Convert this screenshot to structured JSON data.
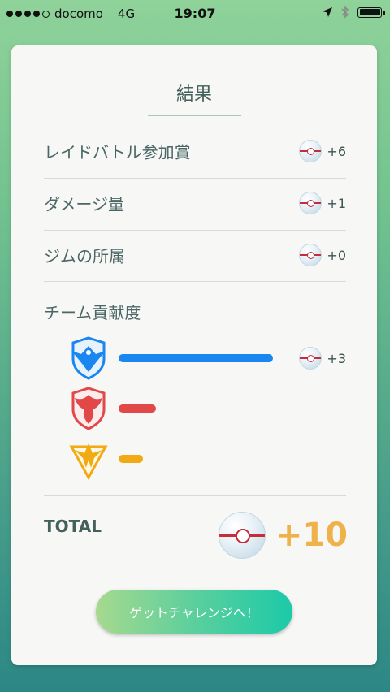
{
  "status_bar": {
    "carrier": "docomo",
    "network": "4G",
    "time": "19:07",
    "icons": [
      "signal-dots-icon",
      "location-arrow-icon",
      "bluetooth-icon",
      "battery-icon"
    ]
  },
  "result": {
    "title": "結果",
    "rows": [
      {
        "label": "レイドバトル参加賞",
        "value": "+6",
        "icon": "premier-ball-icon"
      },
      {
        "label": "ダメージ量",
        "value": "+1",
        "icon": "premier-ball-icon"
      },
      {
        "label": "ジムの所属",
        "value": "+0",
        "icon": "premier-ball-icon"
      }
    ],
    "team_contribution": {
      "label": "チーム貢献度",
      "teams": [
        {
          "name": "mystic",
          "icon": "team-mystic-icon",
          "color": "#1a86f0",
          "share": 1.0,
          "value": "+3"
        },
        {
          "name": "valor",
          "icon": "team-valor-icon",
          "color": "#e14848",
          "share": 0.24,
          "value": ""
        },
        {
          "name": "instinct",
          "icon": "team-instinct-icon",
          "color": "#f2aa14",
          "share": 0.16,
          "value": ""
        }
      ]
    },
    "total_label": "TOTAL",
    "total_value": "+10"
  },
  "cta": {
    "label": "ゲットチャレンジへ！"
  },
  "colors": {
    "accent": "#efb24b",
    "mystic": "#1a86f0",
    "valor": "#e14848",
    "instinct": "#f2aa14"
  }
}
